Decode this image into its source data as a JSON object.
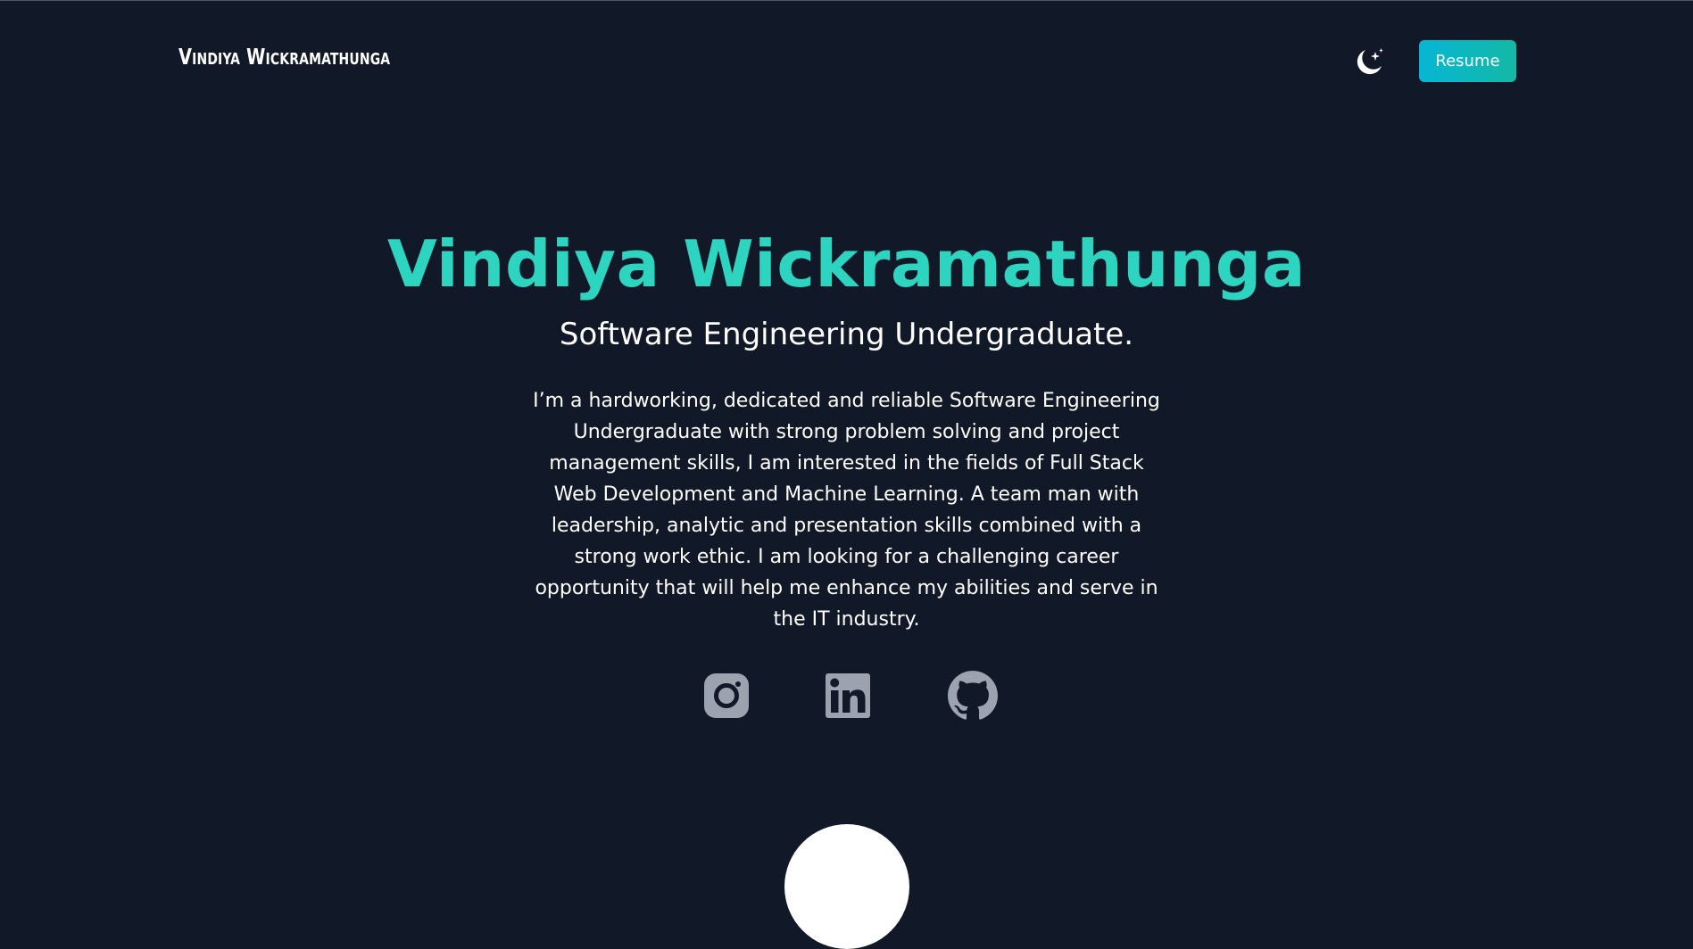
{
  "navbar": {
    "brand": "Vindiya Wickramathunga",
    "theme_toggle_icon": "moon-stars-icon",
    "resume_label": "Resume"
  },
  "hero": {
    "name": "Vindiya Wickramathunga",
    "role": "Software Engineering Undergraduate.",
    "bio": "I’m a hardworking, dedicated and reliable Software Engineering Undergraduate with strong problem solving and project management skills, I am interested in the fields of Full Stack Web Development and Machine Learning. A team man with leadership, analytic and presentation skills combined with a strong work ethic. I am looking for a challenging career opportunity that will help me enhance my abilities and serve in the IT industry."
  },
  "socials": [
    {
      "icon": "instagram-icon"
    },
    {
      "icon": "linkedin-icon"
    },
    {
      "icon": "github-icon"
    }
  ],
  "colors": {
    "background": "#111827",
    "accent": "#2dd4bf",
    "button_gradient_start": "#06b6d4",
    "button_gradient_end": "#14b8a6",
    "icon_gray": "#9ca3af"
  }
}
